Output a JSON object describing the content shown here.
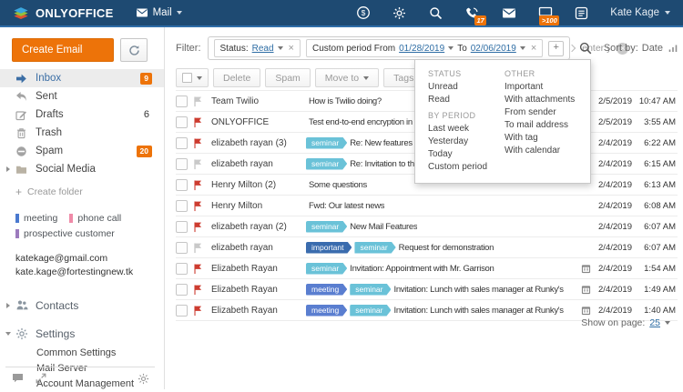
{
  "topbar": {
    "brand": "ONLYOFFICE",
    "module": "Mail",
    "badges": {
      "talk": "17",
      "mail": ">100"
    },
    "user": "Kate Kage"
  },
  "sidebar": {
    "create_button": "Create Email",
    "folders": [
      {
        "label": "Inbox",
        "count": "9"
      },
      {
        "label": "Sent",
        "count": ""
      },
      {
        "label": "Drafts",
        "count": "6"
      },
      {
        "label": "Trash",
        "count": ""
      },
      {
        "label": "Spam",
        "count": "20"
      },
      {
        "label": "Social Media",
        "count": ""
      }
    ],
    "create_folder_label": "Create folder",
    "tags": [
      {
        "label": "meeting",
        "color": "#4a79cf"
      },
      {
        "label": "phone call",
        "color": "#ef8ba8"
      },
      {
        "label": "prospective customer",
        "color": "#9c7bbd"
      }
    ],
    "accounts": [
      "katekage@gmail.com",
      "kate.kage@fortestingnew.tk"
    ],
    "contacts_label": "Contacts",
    "settings_label": "Settings",
    "settings_items": [
      "Common Settings",
      "Mail Server",
      "Account Management"
    ]
  },
  "filter": {
    "label": "Filter:",
    "status_chip": {
      "prefix": "Status:",
      "value": "Read"
    },
    "period_chip": {
      "prefix": "Custom period From",
      "from": "01/28/2019",
      "to_label": "To",
      "to": "02/06/2019"
    },
    "add_button": "+",
    "remove_glyph": "×",
    "clear_glyph": "×",
    "query_placeholder": "enter your query",
    "sort": {
      "label": "Sort by:",
      "value": "Date"
    }
  },
  "filter_dropdown": {
    "status": {
      "header": "STATUS",
      "items": [
        "Unread",
        "Read"
      ]
    },
    "period": {
      "header": "BY PERIOD",
      "items": [
        "Last week",
        "Yesterday",
        "Today",
        "Custom period"
      ]
    },
    "other": {
      "header": "OTHER",
      "items": [
        "Important",
        "With attachments",
        "From sender",
        "To mail address",
        "With tag",
        "With calendar"
      ]
    }
  },
  "toolbar": {
    "buttons": [
      "Delete",
      "Spam",
      "Move to",
      "Tags",
      "..."
    ]
  },
  "emails": [
    {
      "sender": "Team Twilio",
      "subject": "How is Twilio doing?",
      "flag": "gray",
      "tags": [],
      "icon": "",
      "date": "2/5/2019",
      "time": "10:47 AM"
    },
    {
      "sender": "ONLYOFFICE",
      "subject": "Test end-to-end encryption in ON",
      "flag": "red",
      "tags": [],
      "icon": "",
      "date": "2/5/2019",
      "time": "3:55 AM"
    },
    {
      "sender": "elizabeth rayan (3)",
      "subject": "Re: New features",
      "flag": "red",
      "tags": [
        "seminar"
      ],
      "icon": "paperclip",
      "date": "2/4/2019",
      "time": "6:22 AM"
    },
    {
      "sender": "elizabeth rayan",
      "subject": "Re: Invitation to the",
      "flag": "gray",
      "tags": [
        "seminar"
      ],
      "icon": "",
      "date": "2/4/2019",
      "time": "6:15 AM"
    },
    {
      "sender": "Henry Milton (2)",
      "subject": "Some questions",
      "flag": "red",
      "tags": [],
      "icon": "",
      "date": "2/4/2019",
      "time": "6:13 AM"
    },
    {
      "sender": "Henry Milton",
      "subject": "Fwd: Our latest news",
      "flag": "red",
      "tags": [],
      "icon": "",
      "date": "2/4/2019",
      "time": "6:08 AM"
    },
    {
      "sender": "elizabeth rayan (2)",
      "subject": "New Mail Features",
      "flag": "red",
      "tags": [
        "seminar"
      ],
      "icon": "",
      "date": "2/4/2019",
      "time": "6:07 AM"
    },
    {
      "sender": "elizabeth rayan",
      "subject": "Request for demonstration",
      "flag": "gray",
      "tags": [
        "important",
        "seminar"
      ],
      "icon": "",
      "date": "2/4/2019",
      "time": "6:07 AM"
    },
    {
      "sender": "Elizabeth Rayan",
      "subject": "Invitation: Appointment with Mr. Garrison",
      "flag": "red",
      "tags": [
        "seminar"
      ],
      "icon": "calendar",
      "date": "2/4/2019",
      "time": "1:54 AM"
    },
    {
      "sender": "Elizabeth Rayan",
      "subject": "Invitation: Lunch with sales manager at Runky's",
      "flag": "red",
      "tags": [
        "meeting",
        "seminar"
      ],
      "icon": "calendar",
      "date": "2/4/2019",
      "time": "1:49 AM"
    },
    {
      "sender": "Elizabeth Rayan",
      "subject": "Invitation: Lunch with sales manager at Runky's",
      "flag": "red",
      "tags": [
        "meeting",
        "seminar"
      ],
      "icon": "calendar",
      "date": "2/4/2019",
      "time": "1:40 AM"
    }
  ],
  "footer": {
    "label": "Show on page:",
    "value": "25"
  },
  "colors": {
    "header_bg": "#1e4a72",
    "accent_orange": "#ed7309",
    "link_blue": "#2e6da4",
    "tag_colors": {
      "seminar": "#6ac2d8",
      "meeting": "#5a7ed0",
      "important": "#3a6cae"
    }
  }
}
